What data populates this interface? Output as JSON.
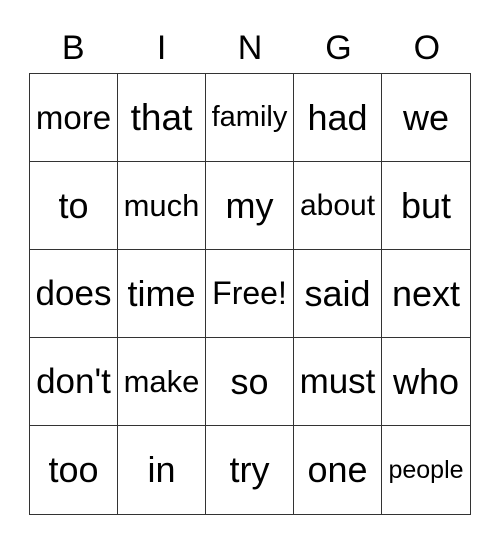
{
  "header": [
    "B",
    "I",
    "N",
    "G",
    "O"
  ],
  "cells": [
    [
      "more",
      "that",
      "family",
      "had",
      "we"
    ],
    [
      "to",
      "much",
      "my",
      "about",
      "but"
    ],
    [
      "does",
      "time",
      "Free!",
      "said",
      "next"
    ],
    [
      "don't",
      "make",
      "so",
      "must",
      "who"
    ],
    [
      "too",
      "in",
      "try",
      "one",
      "people"
    ]
  ]
}
